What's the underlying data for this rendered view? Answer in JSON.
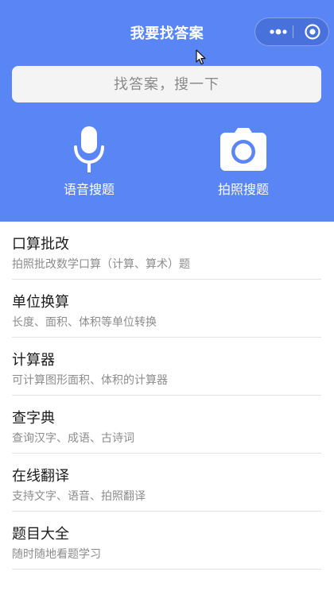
{
  "header": {
    "title": "我要找答案",
    "background_color": "#5a86f5"
  },
  "capsule": {
    "more_icon": "more-dots-icon",
    "close_icon": "target-circle-icon"
  },
  "search": {
    "placeholder": "找答案，搜一下"
  },
  "actions": [
    {
      "label": "语音搜题",
      "icon": "microphone-icon"
    },
    {
      "label": "拍照搜题",
      "icon": "camera-icon"
    }
  ],
  "tools": [
    {
      "name": "口算批改",
      "desc": "拍照批改数学口算（计算、算术）题"
    },
    {
      "name": "单位换算",
      "desc": "长度、面积、体积等单位转换"
    },
    {
      "name": "计算器",
      "desc": "可计算图形面积、体积的计算器"
    },
    {
      "name": "查字典",
      "desc": "查询汉字、成语、古诗词"
    },
    {
      "name": "在线翻译",
      "desc": "支持文字、语音、拍照翻译"
    },
    {
      "name": "题目大全",
      "desc": "随时随地看题学习"
    }
  ]
}
